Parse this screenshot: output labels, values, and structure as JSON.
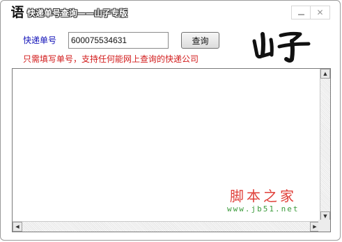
{
  "window": {
    "title": "快递单号查询——山子专版",
    "app_icon_glyph": "语",
    "minimize_glyph": "",
    "close_glyph": "✕"
  },
  "form": {
    "label": "快递单号",
    "tracking_value": "600075534631",
    "query_button": "查询",
    "hint": "只需填写单号，支持任何能网上查询的快递公司"
  },
  "logo": {
    "text": "山子",
    "color": "#111111"
  },
  "watermark": {
    "text": "脚本之家",
    "url": "www.jb51.net"
  },
  "colors": {
    "label": "#1212b8",
    "hint": "#d21a1a",
    "watermark_cn": "#e0403a",
    "watermark_url": "#3a9a3a"
  },
  "icons": {
    "scroll_up": "scroll-up-arrow-icon",
    "scroll_down": "scroll-down-arrow-icon",
    "scroll_left": "scroll-left-arrow-icon",
    "scroll_right": "scroll-right-arrow-icon"
  }
}
